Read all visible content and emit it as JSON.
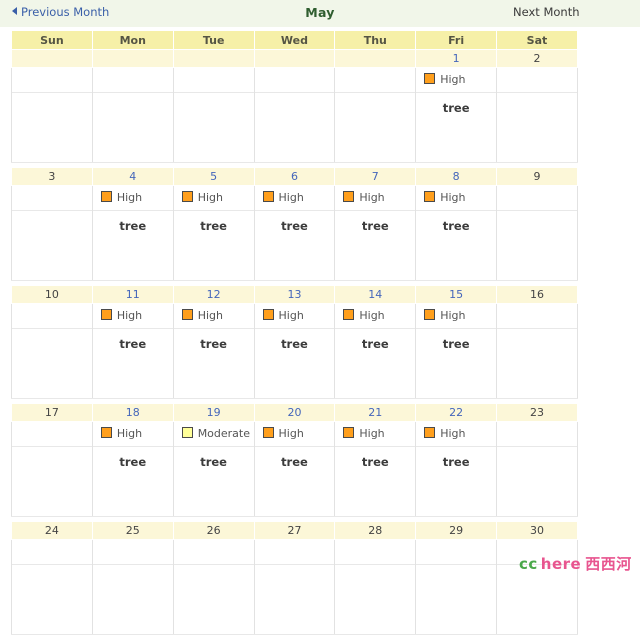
{
  "nav": {
    "prev_label": "Previous Month",
    "title": "May",
    "next_label": "Next Month"
  },
  "weekdays": [
    "Sun",
    "Mon",
    "Tue",
    "Wed",
    "Thu",
    "Fri",
    "Sat"
  ],
  "colors": {
    "high": "#ff9f1c",
    "moderate": "#ffff99",
    "link": "#4466bb",
    "plain": "#444444",
    "header_bg": "#f6f0a8",
    "daynum_bg": "#fcf7d8",
    "nav_bg": "#f1f6e9",
    "title": "#2f5d2f"
  },
  "legend": {
    "high": "High",
    "moderate": "Moderate"
  },
  "pollen_label": "tree",
  "watermark": {
    "cc": "cc",
    "here": "here",
    "cn": "西西河"
  },
  "weeks": [
    {
      "days": [
        {
          "num": "",
          "link": false,
          "level": "",
          "pollen": ""
        },
        {
          "num": "",
          "link": false,
          "level": "",
          "pollen": ""
        },
        {
          "num": "",
          "link": false,
          "level": "",
          "pollen": ""
        },
        {
          "num": "",
          "link": false,
          "level": "",
          "pollen": ""
        },
        {
          "num": "",
          "link": false,
          "level": "",
          "pollen": ""
        },
        {
          "num": "1",
          "link": true,
          "level": "High",
          "pollen": "tree"
        },
        {
          "num": "2",
          "link": false,
          "level": "",
          "pollen": ""
        }
      ]
    },
    {
      "days": [
        {
          "num": "3",
          "link": false,
          "level": "",
          "pollen": ""
        },
        {
          "num": "4",
          "link": true,
          "level": "High",
          "pollen": "tree"
        },
        {
          "num": "5",
          "link": true,
          "level": "High",
          "pollen": "tree"
        },
        {
          "num": "6",
          "link": true,
          "level": "High",
          "pollen": "tree"
        },
        {
          "num": "7",
          "link": true,
          "level": "High",
          "pollen": "tree"
        },
        {
          "num": "8",
          "link": true,
          "level": "High",
          "pollen": "tree"
        },
        {
          "num": "9",
          "link": false,
          "level": "",
          "pollen": ""
        }
      ]
    },
    {
      "days": [
        {
          "num": "10",
          "link": false,
          "level": "",
          "pollen": ""
        },
        {
          "num": "11",
          "link": true,
          "level": "High",
          "pollen": "tree"
        },
        {
          "num": "12",
          "link": true,
          "level": "High",
          "pollen": "tree"
        },
        {
          "num": "13",
          "link": true,
          "level": "High",
          "pollen": "tree"
        },
        {
          "num": "14",
          "link": true,
          "level": "High",
          "pollen": "tree"
        },
        {
          "num": "15",
          "link": true,
          "level": "High",
          "pollen": "tree"
        },
        {
          "num": "16",
          "link": false,
          "level": "",
          "pollen": ""
        }
      ]
    },
    {
      "days": [
        {
          "num": "17",
          "link": false,
          "level": "",
          "pollen": ""
        },
        {
          "num": "18",
          "link": true,
          "level": "High",
          "pollen": "tree"
        },
        {
          "num": "19",
          "link": true,
          "level": "Moderate",
          "pollen": "tree"
        },
        {
          "num": "20",
          "link": true,
          "level": "High",
          "pollen": "tree"
        },
        {
          "num": "21",
          "link": true,
          "level": "High",
          "pollen": "tree"
        },
        {
          "num": "22",
          "link": true,
          "level": "High",
          "pollen": "tree"
        },
        {
          "num": "23",
          "link": false,
          "level": "",
          "pollen": ""
        }
      ]
    },
    {
      "days": [
        {
          "num": "24",
          "link": false,
          "level": "",
          "pollen": ""
        },
        {
          "num": "25",
          "link": false,
          "level": "",
          "pollen": ""
        },
        {
          "num": "26",
          "link": false,
          "level": "",
          "pollen": ""
        },
        {
          "num": "27",
          "link": false,
          "level": "",
          "pollen": ""
        },
        {
          "num": "28",
          "link": false,
          "level": "",
          "pollen": ""
        },
        {
          "num": "29",
          "link": false,
          "level": "",
          "pollen": ""
        },
        {
          "num": "30",
          "link": false,
          "level": "",
          "pollen": ""
        }
      ]
    }
  ]
}
